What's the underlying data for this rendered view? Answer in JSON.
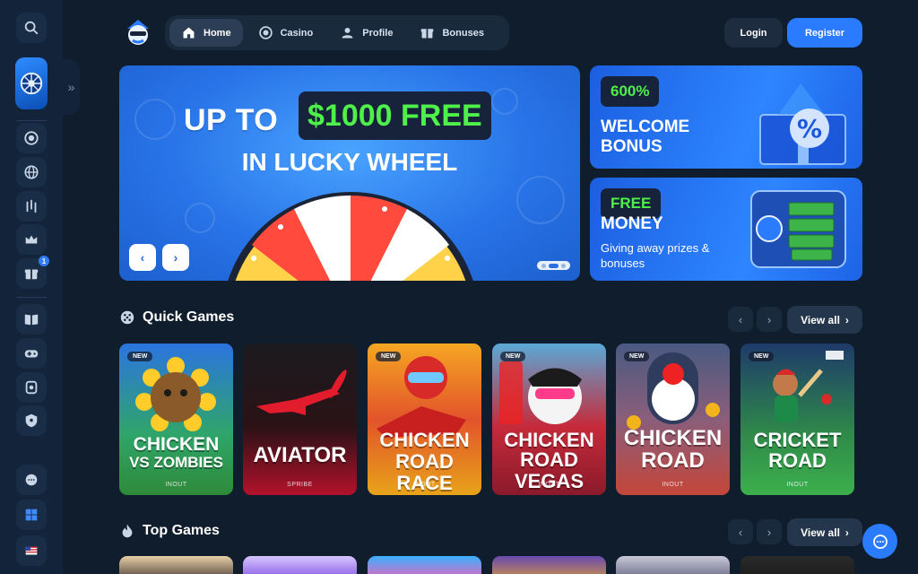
{
  "nav": {
    "items": [
      {
        "label": "Home",
        "icon": "home-icon",
        "active": true
      },
      {
        "label": "Casino",
        "icon": "casino-chip-icon",
        "active": false
      },
      {
        "label": "Profile",
        "icon": "profile-icon",
        "active": false
      },
      {
        "label": "Bonuses",
        "icon": "gift-icon",
        "active": false
      }
    ]
  },
  "auth": {
    "login": "Login",
    "register": "Register"
  },
  "sidebar": {
    "notification_count": "1",
    "icons": [
      "search-icon",
      "lucky-wheel-icon",
      "chip-icon",
      "globe-icon",
      "chart-icon",
      "crown-icon",
      "gift-icon",
      "book-icon",
      "gamepad-icon",
      "trophy-icon",
      "shield-icon",
      "support-icon",
      "windows-icon",
      "flag-us-icon"
    ]
  },
  "hero": {
    "line1_prefix": "UP TO",
    "line1_highlight": "$1000 FREE",
    "line2": "IN LUCKY WHEEL",
    "prev": "‹",
    "next": "›"
  },
  "promos": [
    {
      "tag": "600%",
      "title_lines": [
        "WELCOME",
        "BONUS"
      ],
      "subtitle": ""
    },
    {
      "tag": "FREE",
      "title_lines": [
        "MONEY"
      ],
      "subtitle": "Giving away prizes & bonuses"
    }
  ],
  "quick_games": {
    "title": "Quick Games",
    "view_all": "View all",
    "games": [
      {
        "name_lines": [
          "CHICKEN",
          "VS ZOMBIES"
        ],
        "provider": "INOUT",
        "is_new": true,
        "new_label": "NEW"
      },
      {
        "name_lines": [
          "AVIATOR"
        ],
        "provider": "SPRIBE",
        "is_new": false,
        "new_label": ""
      },
      {
        "name_lines": [
          "CHICKEN",
          "ROAD RACE"
        ],
        "provider": "INOUT",
        "is_new": true,
        "new_label": "NEW"
      },
      {
        "name_lines": [
          "CHICKEN",
          "ROAD VEGAS"
        ],
        "provider": "INOUT",
        "is_new": true,
        "new_label": "NEW"
      },
      {
        "name_lines": [
          "CHICKEN",
          "ROAD"
        ],
        "provider": "INOUT",
        "is_new": true,
        "new_label": "NEW"
      },
      {
        "name_lines": [
          "CRICKET",
          "ROAD"
        ],
        "provider": "INOUT",
        "is_new": true,
        "new_label": "NEW"
      }
    ]
  },
  "top_games": {
    "title": "Top Games",
    "view_all": "View all"
  },
  "colors": {
    "accent": "#2b7bff",
    "highlight_green": "#4ff04a",
    "bg": "#0f1d2c"
  }
}
